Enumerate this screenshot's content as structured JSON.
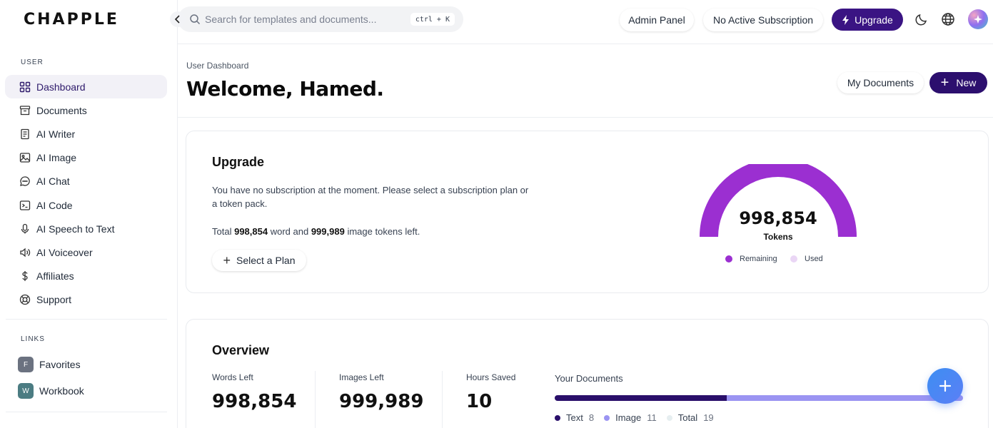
{
  "app": {
    "logo": "CHAPPLE"
  },
  "sidebar": {
    "user_label": "USER",
    "items": [
      {
        "label": "Dashboard",
        "icon": "grid-icon",
        "active": true
      },
      {
        "label": "Documents",
        "icon": "archive-icon"
      },
      {
        "label": "AI Writer",
        "icon": "document-icon"
      },
      {
        "label": "AI Image",
        "icon": "image-icon"
      },
      {
        "label": "AI Chat",
        "icon": "chat-icon"
      },
      {
        "label": "AI Code",
        "icon": "terminal-icon"
      },
      {
        "label": "AI Speech to Text",
        "icon": "microphone-icon"
      },
      {
        "label": "AI Voiceover",
        "icon": "speaker-icon"
      },
      {
        "label": "Affiliates",
        "icon": "dollar-icon"
      },
      {
        "label": "Support",
        "icon": "lifebuoy-icon"
      }
    ],
    "links_label": "LINKS",
    "links": [
      {
        "badge": "F",
        "label": "Favorites",
        "color": "#6b7280"
      },
      {
        "badge": "W",
        "label": "Workbook",
        "color": "#4b7c82"
      }
    ]
  },
  "topbar": {
    "search_placeholder": "Search for templates and documents...",
    "shortcut": "ctrl + K",
    "admin_panel": "Admin Panel",
    "subscription": "No Active Subscription",
    "upgrade": "Upgrade"
  },
  "header": {
    "breadcrumb": "User Dashboard",
    "title": "Welcome, Hamed.",
    "my_documents": "My Documents",
    "new": "New"
  },
  "upgrade_card": {
    "title": "Upgrade",
    "message": "You have no subscription at the moment. Please select a subscription plan or a token pack.",
    "tokens_prefix": "Total",
    "word_tokens": "998,854",
    "tokens_middle": "word and",
    "image_tokens": "999,989",
    "tokens_suffix": "image tokens left.",
    "select_plan": "Select a Plan",
    "gauge_value": "998,854",
    "gauge_label": "Tokens",
    "gauge_remaining_fraction": 1.0,
    "legend_remaining": "Remaining",
    "legend_used": "Used",
    "colors": {
      "remaining": "#9b2fd1",
      "used": "#ead6f5"
    }
  },
  "overview": {
    "title": "Overview",
    "stats": [
      {
        "label": "Words Left",
        "value": "998,854"
      },
      {
        "label": "Images Left",
        "value": "999,989"
      },
      {
        "label": "Hours Saved",
        "value": "10"
      }
    ],
    "documents_title": "Your Documents",
    "documents": {
      "text_label": "Text",
      "text_count": 8,
      "image_label": "Image",
      "image_count": 11,
      "total_label": "Total",
      "total_count": 19
    },
    "colors": {
      "text": "#2a0f6a",
      "image": "#9b94f2",
      "total": "#e6eef0"
    }
  }
}
